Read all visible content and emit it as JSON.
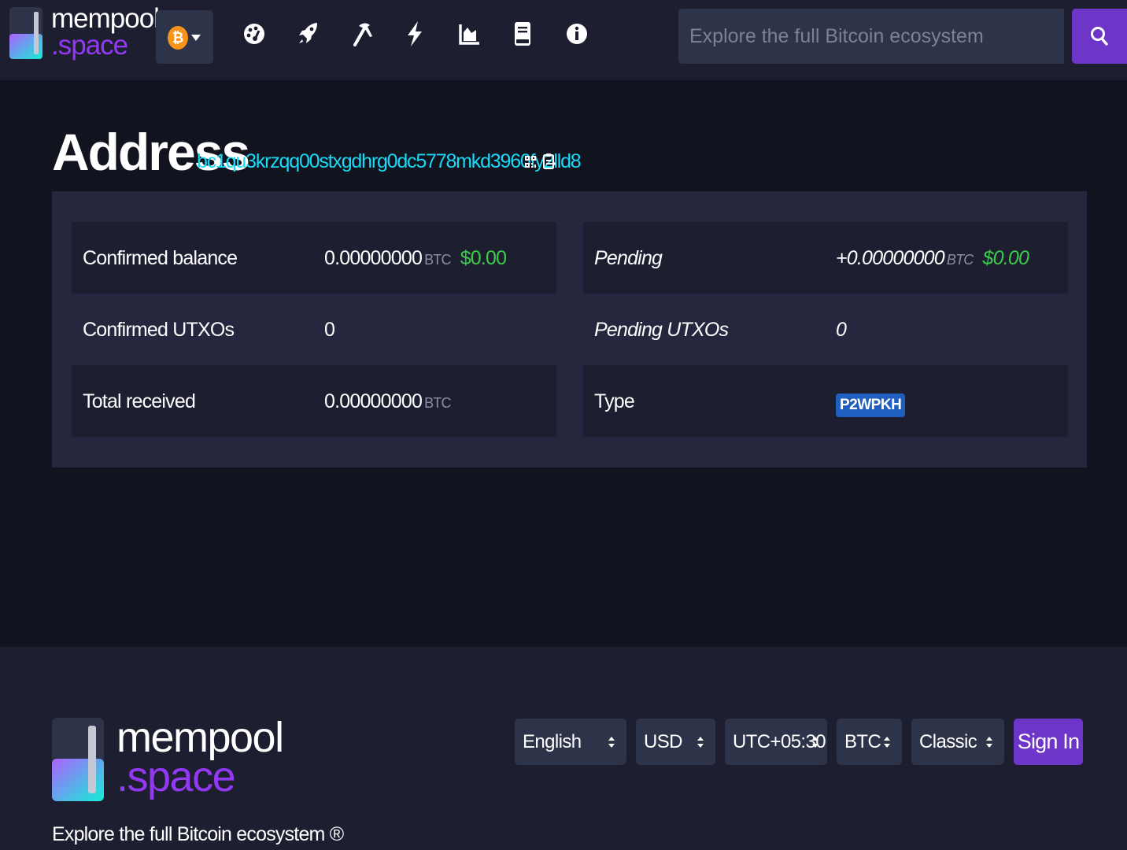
{
  "header": {
    "logo": {
      "line1": "mempool",
      "line2": ".space"
    },
    "network_icon": "bitcoin-icon",
    "nav_icons": [
      "dashboard-icon",
      "rocket-icon",
      "mining-icon",
      "lightning-icon",
      "graphs-icon",
      "docs-icon",
      "about-icon"
    ],
    "search": {
      "placeholder": "Explore the full Bitcoin ecosystem",
      "button_icon": "search-icon"
    }
  },
  "address": {
    "title": "Address",
    "value": "bc1qu3krzqq00stxgdhrg0dc5778mkd3960fy2lld8"
  },
  "details": {
    "left": [
      {
        "label": "Confirmed balance",
        "amount": "0.00000000",
        "unit": "BTC",
        "fiat": "$0.00"
      },
      {
        "label": "Confirmed UTXOs",
        "amount": "0"
      },
      {
        "label": "Total received",
        "amount": "0.00000000",
        "unit": "BTC"
      }
    ],
    "right": [
      {
        "label": "Pending",
        "amount": "+0.00000000",
        "unit": "BTC",
        "fiat": "$0.00"
      },
      {
        "label": "Pending UTXOs",
        "amount": "0"
      },
      {
        "label": "Type",
        "badge": "P2WPKH"
      }
    ]
  },
  "footer": {
    "logo": {
      "line1": "mempool",
      "line2": ".space"
    },
    "tagline": "Explore the full Bitcoin ecosystem ®",
    "selectors": {
      "language": "English",
      "currency": "USD",
      "timezone": "UTC+05:30",
      "denomination": "BTC",
      "theme": "Classic"
    },
    "sign_in": "Sign In"
  },
  "colors": {
    "background": "#11131f",
    "bar": "#1d1f31",
    "accent": "#6e35c9",
    "link": "#1bd8f4",
    "fiat": "#3bcc49",
    "badge": "#1f5fbf"
  }
}
